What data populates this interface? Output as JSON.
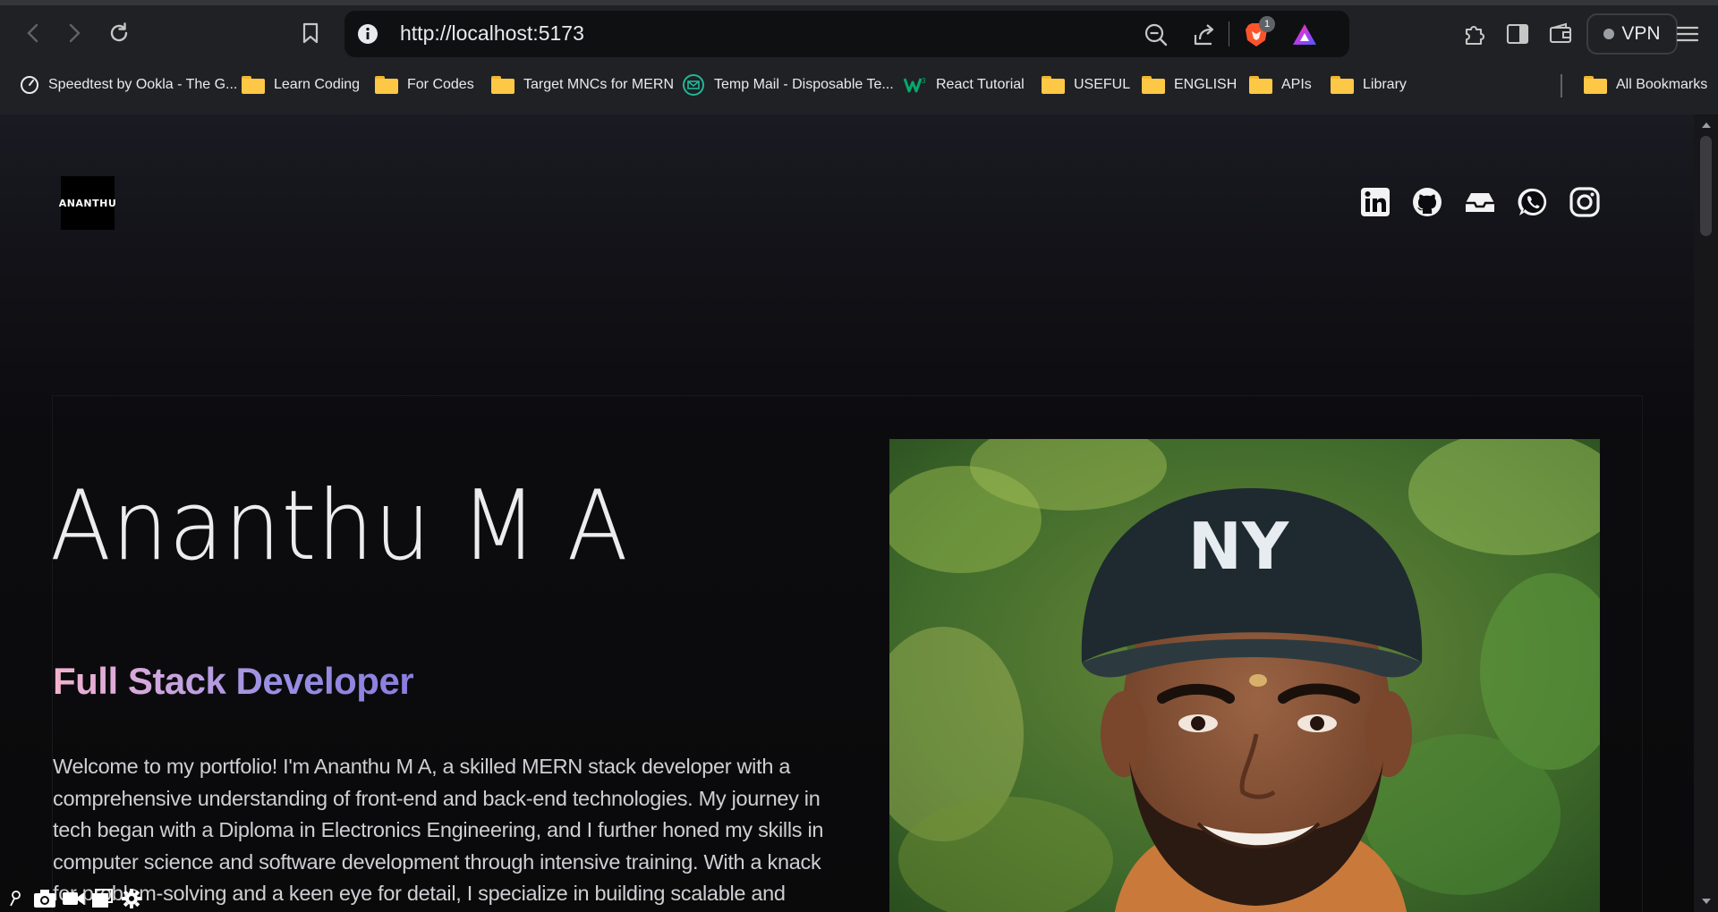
{
  "browser": {
    "url": "http://localhost:5173",
    "shield_count": "1",
    "vpn_label": "VPN",
    "bookmarks": [
      {
        "label": "Speedtest by Ookla - The G...",
        "icon": "speedtest-icon"
      },
      {
        "label": "Learn Coding",
        "icon": "folder-icon"
      },
      {
        "label": "For Codes",
        "icon": "folder-icon"
      },
      {
        "label": "Target MNCs for MERN",
        "icon": "folder-icon"
      },
      {
        "label": "Temp Mail - Disposable Te...",
        "icon": "tempmail-icon"
      },
      {
        "label": "React Tutorial",
        "icon": "w3schools-icon"
      },
      {
        "label": "USEFUL",
        "icon": "folder-icon"
      },
      {
        "label": "ENGLISH",
        "icon": "folder-icon"
      },
      {
        "label": "APIs",
        "icon": "folder-icon"
      },
      {
        "label": "Library",
        "icon": "folder-icon"
      }
    ],
    "all_bookmarks_label": "All Bookmarks"
  },
  "header": {
    "logo_text": "ANANTHU",
    "social_icons": [
      "linkedin-icon",
      "github-icon",
      "inbox-icon",
      "whatsapp-icon",
      "instagram-icon"
    ]
  },
  "hero": {
    "name": "Ananthu M A",
    "role": "Full Stack Developer",
    "bio": "Welcome to my portfolio! I'm Ananthu M A, a skilled MERN stack developer with a comprehensive understanding of front-end and back-end technologies. My journey in tech began with a Diploma in Electronics Engineering, and I further honed my skills in computer science and software development through intensive training. With a knack for problem-solving and a keen eye for detail, I specialize in building scalable and",
    "cap_text": "NY"
  },
  "colors": {
    "page_bg": "#0a0a0b",
    "role_gradient_start": "#f3b2cf",
    "role_gradient_end": "#8b7de0",
    "chrome_bg": "#202124"
  }
}
